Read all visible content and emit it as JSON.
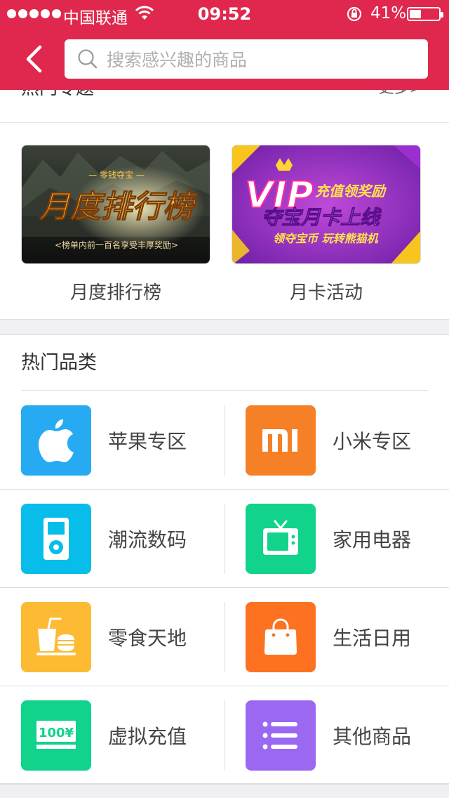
{
  "status_bar": {
    "carrier": "中国联通",
    "time": "09:52",
    "battery": "41%",
    "battery_level": 0.41
  },
  "search": {
    "placeholder": "搜索感兴趣的商品"
  },
  "hot_topics": {
    "title": "热门专题",
    "more": "更多>",
    "items": [
      {
        "caption": "月度排行榜",
        "banner_top": "— 零钱夺宝 —",
        "banner_title": "月度排行榜",
        "banner_sub": "<榜单内前一百名享受丰厚奖励>"
      },
      {
        "caption": "月卡活动",
        "banner_vip": "VIP",
        "banner_line1": "充值领奖励",
        "banner_line2": "夺宝月卡上线",
        "banner_line3": "领夺宝币 玩转熊猫机"
      }
    ]
  },
  "hot_categories": {
    "title": "热门品类",
    "items": [
      {
        "label": "苹果专区",
        "icon": "apple-icon",
        "color": "#26aaf2"
      },
      {
        "label": "小米专区",
        "icon": "mi-icon",
        "color": "#f58025"
      },
      {
        "label": "潮流数码",
        "icon": "ipod-icon",
        "color": "#08bde9"
      },
      {
        "label": "家用电器",
        "icon": "tv-icon",
        "color": "#11d38b"
      },
      {
        "label": "零食天地",
        "icon": "snack-icon",
        "color": "#fcbb32"
      },
      {
        "label": "生活日用",
        "icon": "shopping-bag-icon",
        "color": "#fd7221"
      },
      {
        "label": "虚拟充值",
        "icon": "recharge-card-icon",
        "color": "#11d38b",
        "icon_text": "100¥"
      },
      {
        "label": "其他商品",
        "icon": "list-icon",
        "color": "#9b68f2"
      }
    ]
  }
}
